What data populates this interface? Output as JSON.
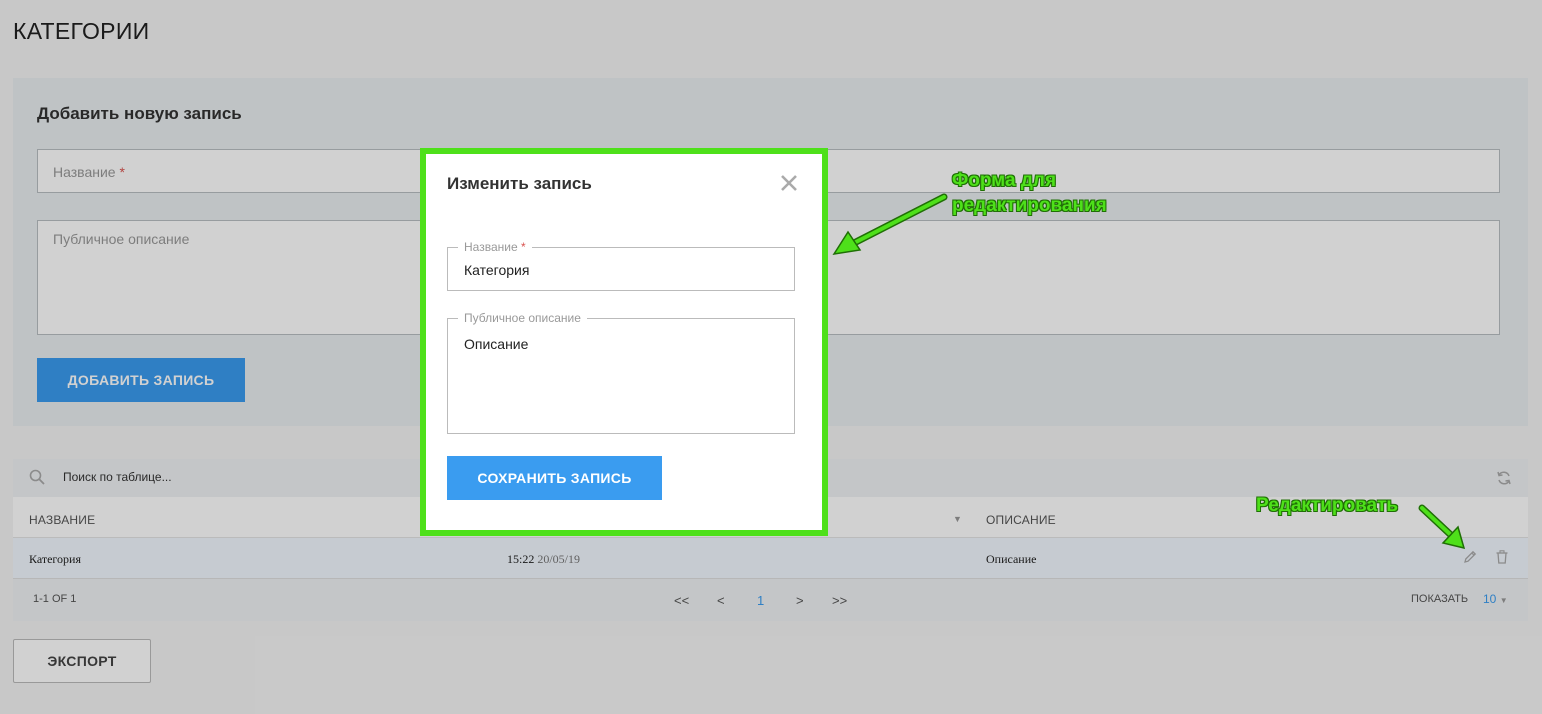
{
  "page": {
    "title": "КАТЕГОРИИ"
  },
  "add_form": {
    "title": "Добавить новую запись",
    "name_placeholder": "Название",
    "required_mark": "*",
    "desc_placeholder": "Публичное описание",
    "submit_label": "ДОБАВИТЬ ЗАПИСЬ"
  },
  "table": {
    "search_placeholder": "Поиск по таблице...",
    "columns": [
      "НАЗВАНИЕ",
      "ОПИСАНИЕ"
    ],
    "rows": [
      {
        "name": "Категория",
        "time": "15:22",
        "date": "20/05/19",
        "description": "Описание"
      }
    ],
    "pager": {
      "count": "1-1 OF 1",
      "first": "<<",
      "prev": "<",
      "current": "1",
      "next": ">",
      "last": ">>",
      "show_label": "ПОКАЗАТЬ",
      "page_size": "10"
    }
  },
  "export_label": "ЭКСПОРТ",
  "modal": {
    "title": "Изменить запись",
    "name_label": "Название",
    "required_mark": "*",
    "name_value": "Категория",
    "desc_label": "Публичное описание",
    "desc_value": "Описание",
    "save_label": "СОХРАНИТЬ ЗАПИСЬ"
  },
  "annotations": {
    "form_line1": "Форма для",
    "form_line2": "редактирования",
    "edit": "Редактировать"
  },
  "colors": {
    "accent": "#3a9cf0",
    "highlight": "#4ee01a"
  }
}
